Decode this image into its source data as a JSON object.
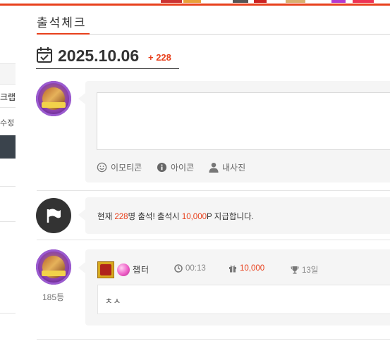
{
  "sidebar": {
    "partial_text_1": "크랩",
    "partial_text_2": "수정"
  },
  "header": {
    "title": "출석체크"
  },
  "date_section": {
    "date": "2025.10.06",
    "today_count": "+ 228"
  },
  "comment_form": {
    "tools": [
      {
        "icon": "smile-icon",
        "label": "이모티콘"
      },
      {
        "icon": "info-icon",
        "label": "아이콘"
      },
      {
        "icon": "user-icon",
        "label": "내사진"
      }
    ]
  },
  "notice": {
    "prefix": "현재 ",
    "count": "228",
    "middle": "명 출석! 출석시 ",
    "points": "10,000",
    "suffix": "P 지급합니다."
  },
  "attendance_entry": {
    "rank": "185등",
    "name": "챕터",
    "time": "00:13",
    "points": "10,000",
    "streak": "13일",
    "message": "ㅊㅅ"
  },
  "colors": {
    "accent": "#e8401c",
    "card_bg": "#f5f5f5",
    "text": "#333333"
  }
}
